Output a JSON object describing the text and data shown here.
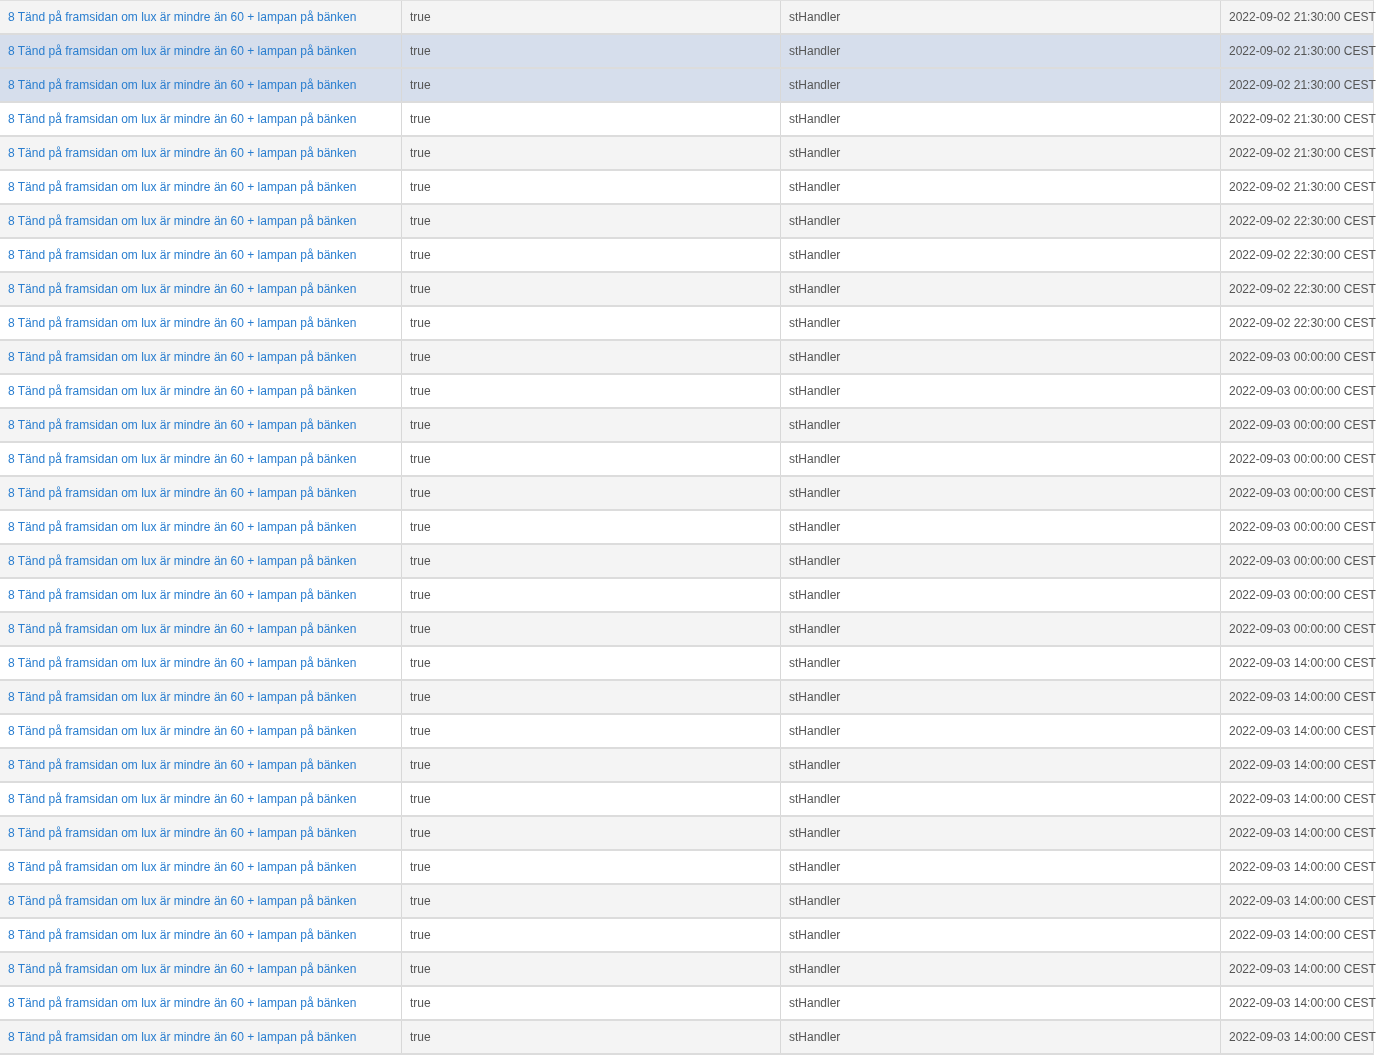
{
  "table": {
    "rows": [
      {
        "selected": false,
        "column_1": "8 Tänd på framsidan om lux är mindre än 60 + lampan på bänken",
        "column_2": "true",
        "column_3": "stHandler",
        "column_4": "2022-09-02 21:30:00 CEST"
      },
      {
        "selected": true,
        "column_1": "8 Tänd på framsidan om lux är mindre än 60 + lampan på bänken",
        "column_2": "true",
        "column_3": "stHandler",
        "column_4": "2022-09-02 21:30:00 CEST"
      },
      {
        "selected": true,
        "column_1": "8 Tänd på framsidan om lux är mindre än 60 + lampan på bänken",
        "column_2": "true",
        "column_3": "stHandler",
        "column_4": "2022-09-02 21:30:00 CEST"
      },
      {
        "selected": false,
        "column_1": "8 Tänd på framsidan om lux är mindre än 60 + lampan på bänken",
        "column_2": "true",
        "column_3": "stHandler",
        "column_4": "2022-09-02 21:30:00 CEST"
      },
      {
        "selected": false,
        "column_1": "8 Tänd på framsidan om lux är mindre än 60 + lampan på bänken",
        "column_2": "true",
        "column_3": "stHandler",
        "column_4": "2022-09-02 21:30:00 CEST"
      },
      {
        "selected": false,
        "column_1": "8 Tänd på framsidan om lux är mindre än 60 + lampan på bänken",
        "column_2": "true",
        "column_3": "stHandler",
        "column_4": "2022-09-02 21:30:00 CEST"
      },
      {
        "selected": false,
        "column_1": "8 Tänd på framsidan om lux är mindre än 60 + lampan på bänken",
        "column_2": "true",
        "column_3": "stHandler",
        "column_4": "2022-09-02 22:30:00 CEST"
      },
      {
        "selected": false,
        "column_1": "8 Tänd på framsidan om lux är mindre än 60 + lampan på bänken",
        "column_2": "true",
        "column_3": "stHandler",
        "column_4": "2022-09-02 22:30:00 CEST"
      },
      {
        "selected": false,
        "column_1": "8 Tänd på framsidan om lux är mindre än 60 + lampan på bänken",
        "column_2": "true",
        "column_3": "stHandler",
        "column_4": "2022-09-02 22:30:00 CEST"
      },
      {
        "selected": false,
        "column_1": "8 Tänd på framsidan om lux är mindre än 60 + lampan på bänken",
        "column_2": "true",
        "column_3": "stHandler",
        "column_4": "2022-09-02 22:30:00 CEST"
      },
      {
        "selected": false,
        "column_1": "8 Tänd på framsidan om lux är mindre än 60 + lampan på bänken",
        "column_2": "true",
        "column_3": "stHandler",
        "column_4": "2022-09-03 00:00:00 CEST"
      },
      {
        "selected": false,
        "column_1": "8 Tänd på framsidan om lux är mindre än 60 + lampan på bänken",
        "column_2": "true",
        "column_3": "stHandler",
        "column_4": "2022-09-03 00:00:00 CEST"
      },
      {
        "selected": false,
        "column_1": "8 Tänd på framsidan om lux är mindre än 60 + lampan på bänken",
        "column_2": "true",
        "column_3": "stHandler",
        "column_4": "2022-09-03 00:00:00 CEST"
      },
      {
        "selected": false,
        "column_1": "8 Tänd på framsidan om lux är mindre än 60 + lampan på bänken",
        "column_2": "true",
        "column_3": "stHandler",
        "column_4": "2022-09-03 00:00:00 CEST"
      },
      {
        "selected": false,
        "column_1": "8 Tänd på framsidan om lux är mindre än 60 + lampan på bänken",
        "column_2": "true",
        "column_3": "stHandler",
        "column_4": "2022-09-03 00:00:00 CEST"
      },
      {
        "selected": false,
        "column_1": "8 Tänd på framsidan om lux är mindre än 60 + lampan på bänken",
        "column_2": "true",
        "column_3": "stHandler",
        "column_4": "2022-09-03 00:00:00 CEST"
      },
      {
        "selected": false,
        "column_1": "8 Tänd på framsidan om lux är mindre än 60 + lampan på bänken",
        "column_2": "true",
        "column_3": "stHandler",
        "column_4": "2022-09-03 00:00:00 CEST"
      },
      {
        "selected": false,
        "column_1": "8 Tänd på framsidan om lux är mindre än 60 + lampan på bänken",
        "column_2": "true",
        "column_3": "stHandler",
        "column_4": "2022-09-03 00:00:00 CEST"
      },
      {
        "selected": false,
        "column_1": "8 Tänd på framsidan om lux är mindre än 60 + lampan på bänken",
        "column_2": "true",
        "column_3": "stHandler",
        "column_4": "2022-09-03 00:00:00 CEST"
      },
      {
        "selected": false,
        "column_1": "8 Tänd på framsidan om lux är mindre än 60 + lampan på bänken",
        "column_2": "true",
        "column_3": "stHandler",
        "column_4": "2022-09-03 14:00:00 CEST"
      },
      {
        "selected": false,
        "column_1": "8 Tänd på framsidan om lux är mindre än 60 + lampan på bänken",
        "column_2": "true",
        "column_3": "stHandler",
        "column_4": "2022-09-03 14:00:00 CEST"
      },
      {
        "selected": false,
        "column_1": "8 Tänd på framsidan om lux är mindre än 60 + lampan på bänken",
        "column_2": "true",
        "column_3": "stHandler",
        "column_4": "2022-09-03 14:00:00 CEST"
      },
      {
        "selected": false,
        "column_1": "8 Tänd på framsidan om lux är mindre än 60 + lampan på bänken",
        "column_2": "true",
        "column_3": "stHandler",
        "column_4": "2022-09-03 14:00:00 CEST"
      },
      {
        "selected": false,
        "column_1": "8 Tänd på framsidan om lux är mindre än 60 + lampan på bänken",
        "column_2": "true",
        "column_3": "stHandler",
        "column_4": "2022-09-03 14:00:00 CEST"
      },
      {
        "selected": false,
        "column_1": "8 Tänd på framsidan om lux är mindre än 60 + lampan på bänken",
        "column_2": "true",
        "column_3": "stHandler",
        "column_4": "2022-09-03 14:00:00 CEST"
      },
      {
        "selected": false,
        "column_1": "8 Tänd på framsidan om lux är mindre än 60 + lampan på bänken",
        "column_2": "true",
        "column_3": "stHandler",
        "column_4": "2022-09-03 14:00:00 CEST"
      },
      {
        "selected": false,
        "column_1": "8 Tänd på framsidan om lux är mindre än 60 + lampan på bänken",
        "column_2": "true",
        "column_3": "stHandler",
        "column_4": "2022-09-03 14:00:00 CEST"
      },
      {
        "selected": false,
        "column_1": "8 Tänd på framsidan om lux är mindre än 60 + lampan på bänken",
        "column_2": "true",
        "column_3": "stHandler",
        "column_4": "2022-09-03 14:00:00 CEST"
      },
      {
        "selected": false,
        "column_1": "8 Tänd på framsidan om lux är mindre än 60 + lampan på bänken",
        "column_2": "true",
        "column_3": "stHandler",
        "column_4": "2022-09-03 14:00:00 CEST"
      },
      {
        "selected": false,
        "column_1": "8 Tänd på framsidan om lux är mindre än 60 + lampan på bänken",
        "column_2": "true",
        "column_3": "stHandler",
        "column_4": "2022-09-03 14:00:00 CEST"
      },
      {
        "selected": false,
        "column_1": "8 Tänd på framsidan om lux är mindre än 60 + lampan på bänken",
        "column_2": "true",
        "column_3": "stHandler",
        "column_4": "2022-09-03 14:00:00 CEST"
      }
    ]
  }
}
